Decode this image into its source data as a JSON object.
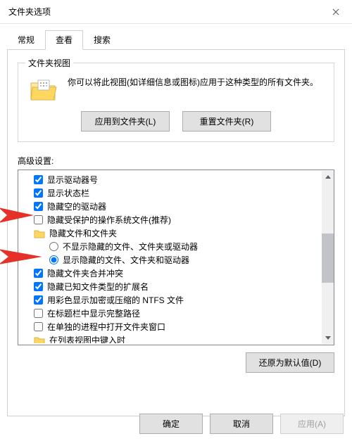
{
  "title": "文件夹选项",
  "tabs": {
    "general": "常规",
    "view": "查看",
    "search": "搜索"
  },
  "folderview": {
    "legend": "文件夹视图",
    "text": "你可以将此视图(如详细信息或图标)应用于这种类型的所有文件夹。",
    "apply_btn": "应用到文件夹(L)",
    "reset_btn": "重置文件夹(R)"
  },
  "advanced": {
    "label": "高级设置:",
    "items": [
      {
        "kind": "check",
        "checked": true,
        "label": "显示驱动器号"
      },
      {
        "kind": "check",
        "checked": true,
        "label": "显示状态栏"
      },
      {
        "kind": "check",
        "checked": true,
        "label": "隐藏空的驱动器"
      },
      {
        "kind": "check",
        "checked": false,
        "label": "隐藏受保护的操作系统文件(推荐)"
      },
      {
        "kind": "folder",
        "label": "隐藏文件和文件夹"
      },
      {
        "kind": "radio",
        "checked": false,
        "label": "不显示隐藏的文件、文件夹或驱动器"
      },
      {
        "kind": "radio",
        "checked": true,
        "label": "显示隐藏的文件、文件夹和驱动器"
      },
      {
        "kind": "check",
        "checked": true,
        "label": "隐藏文件夹合并冲突"
      },
      {
        "kind": "check",
        "checked": true,
        "label": "隐藏已知文件类型的扩展名"
      },
      {
        "kind": "check",
        "checked": true,
        "label": "用彩色显示加密或压缩的 NTFS 文件"
      },
      {
        "kind": "check",
        "checked": false,
        "label": "在标题栏中显示完整路径"
      },
      {
        "kind": "check",
        "checked": false,
        "label": "在单独的进程中打开文件夹窗口"
      },
      {
        "kind": "folder",
        "label": "在列表视图中键入时"
      }
    ],
    "restore_btn": "还原为默认值(D)"
  },
  "buttons": {
    "ok": "确定",
    "cancel": "取消",
    "apply": "应用(A)"
  }
}
